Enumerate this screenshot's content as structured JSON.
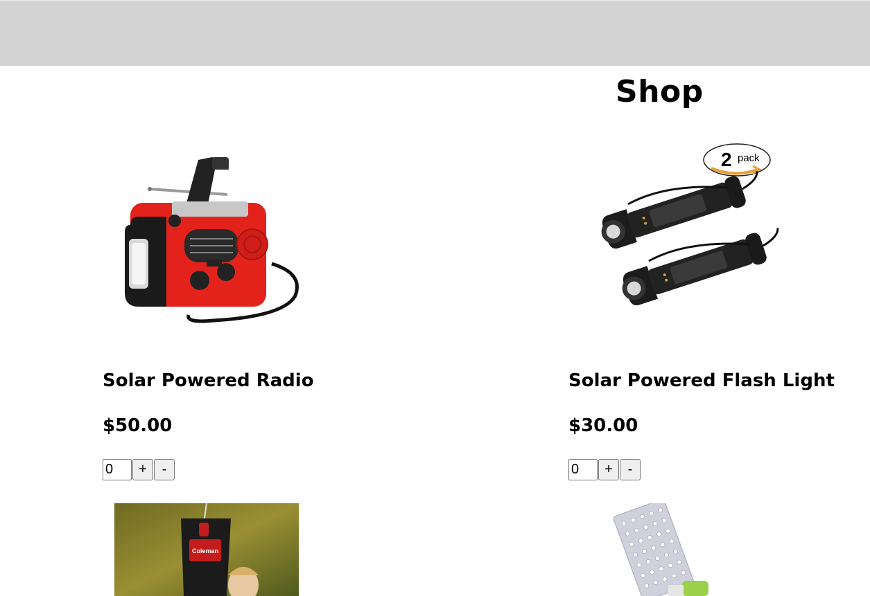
{
  "header": {
    "title": "Shop"
  },
  "products": [
    {
      "name": "Solar Powered Radio",
      "price": "$50.00",
      "quantity": "0",
      "plus_label": "+",
      "minus_label": "-",
      "icon": "hand-crank-radio-icon"
    },
    {
      "name": "Solar Powered Flash Light",
      "price": "$30.00",
      "quantity": "0",
      "plus_label": "+",
      "minus_label": "-",
      "icon": "flashlight-icon",
      "badge_number": "2",
      "badge_text": "pack"
    }
  ],
  "lower_products": [
    {
      "icon": "solar-shower-icon",
      "brand_text": "Coleman"
    },
    {
      "icon": "led-lamp-icon"
    }
  ],
  "colors": {
    "header_bg": "#d3d3d3",
    "radio_red": "#e3231b",
    "badge_arrow": "#e8a033"
  }
}
